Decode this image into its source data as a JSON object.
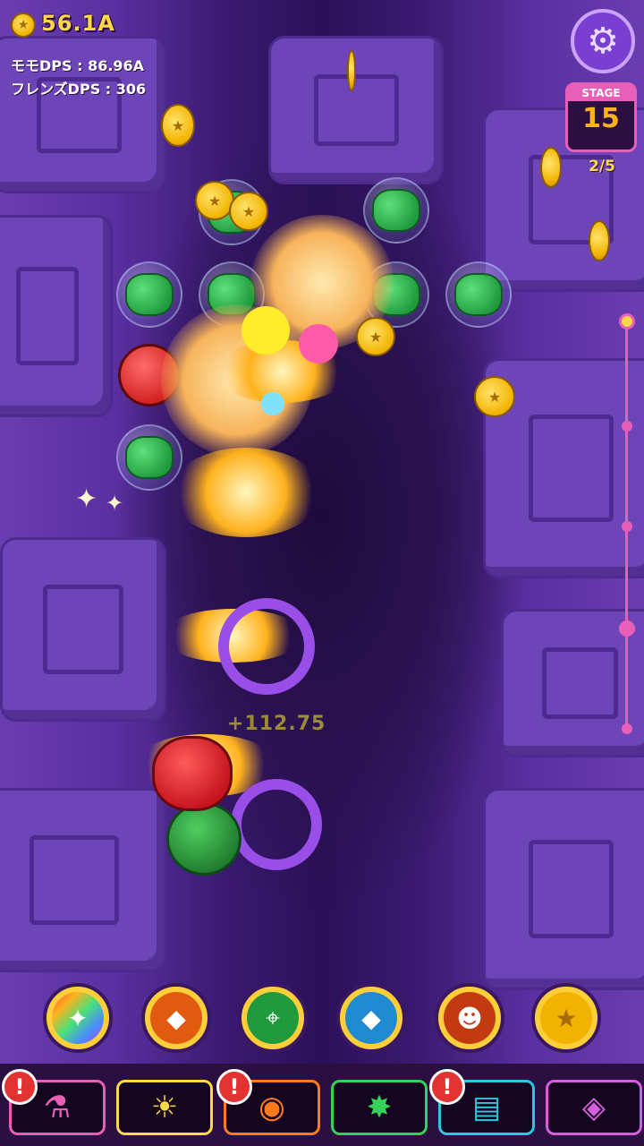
{
  "hud": {
    "coins": "56.1A",
    "momo_dps": "モモDPS : 86.96A",
    "friends_dps": "フレンズDPS : 306"
  },
  "stage": {
    "label": "STAGE",
    "number": "15",
    "progress": "2/5"
  },
  "field": {
    "damage_popup": "+112.75"
  },
  "skills": [
    {
      "icon": "rainbow-comet-icon"
    },
    {
      "icon": "orange-capsule-icon"
    },
    {
      "icon": "target-crosshair-icon"
    },
    {
      "icon": "blue-capsule-icon"
    },
    {
      "icon": "pumpkin-bomb-icon"
    },
    {
      "icon": "gold-coin-icon"
    }
  ],
  "tabs": [
    {
      "icon": "upgrade-potion-icon",
      "border": "#e85fb7",
      "alert": true
    },
    {
      "icon": "sun-lightbulb-icon",
      "border": "#ffd84a",
      "alert": false
    },
    {
      "icon": "bomb-flask-icon",
      "border": "#ff7a1e",
      "alert": true
    },
    {
      "icon": "friend-burst-icon",
      "border": "#36d15a",
      "alert": false
    },
    {
      "icon": "quest-scroll-icon",
      "border": "#2fc6e0",
      "alert": true
    },
    {
      "icon": "gem-shop-icon",
      "border": "#d65fe0",
      "alert": false
    }
  ],
  "colors": {
    "accent_pink": "#e85fb7",
    "gold": "#ffd84a",
    "ring_purple": "#9a4ee8"
  }
}
